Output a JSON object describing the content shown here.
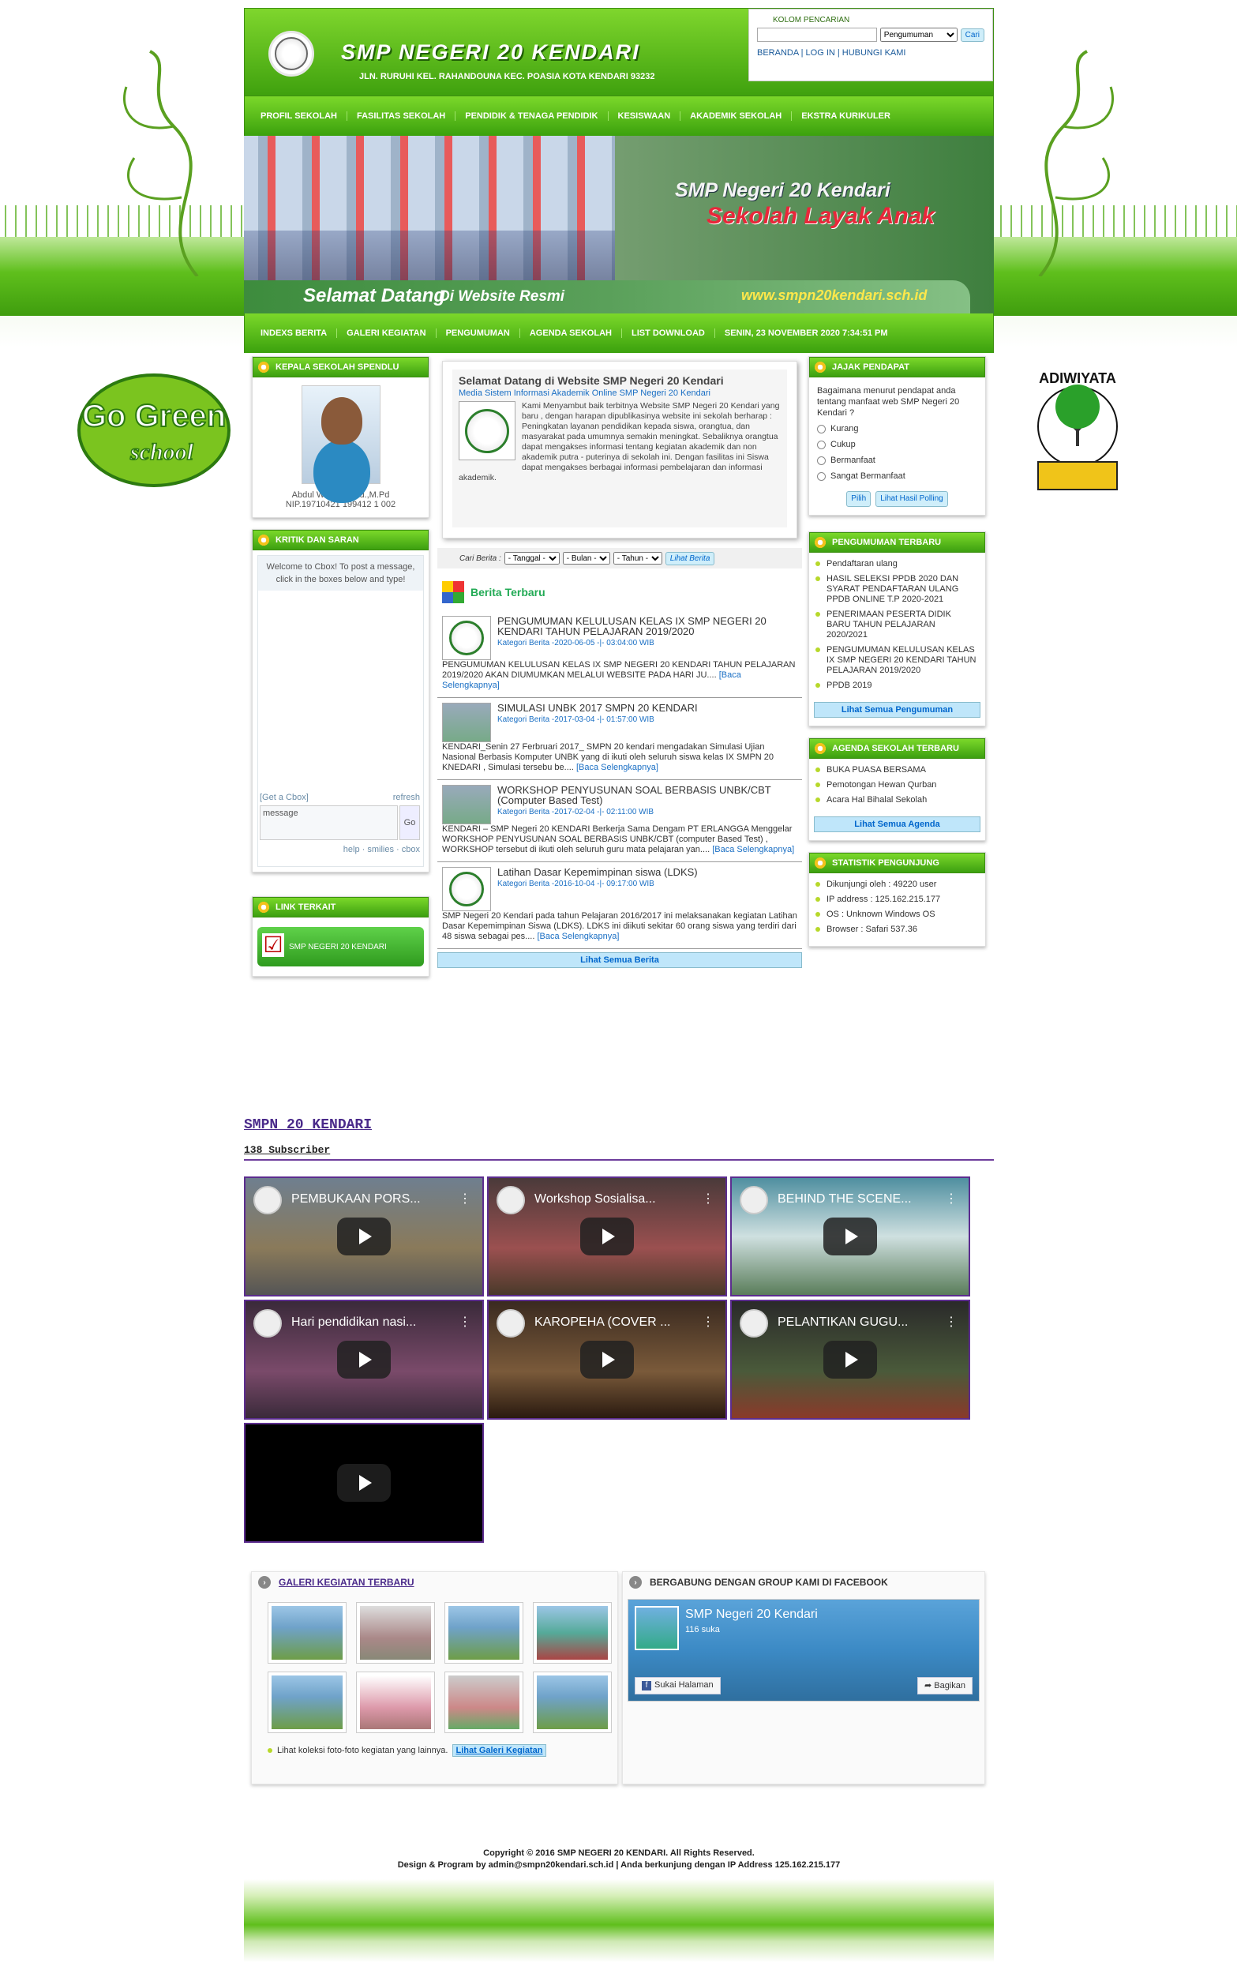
{
  "header": {
    "school_name": "SMP NEGERI 20 KENDARI",
    "address": "JLN. RURUHI KEL. RAHANDOUNA KEC. POASIA KOTA KENDARI 93232",
    "search_title": "KOLOM PENCARIAN",
    "search_select": "Pengumuman",
    "search_button": "Cari",
    "links": "BERANDA | LOG IN | HUBUNGI KAMI"
  },
  "nav1": [
    "PROFIL SEKOLAH",
    "FASILITAS SEKOLAH",
    "PENDIDIK & TENAGA PENDIDIK",
    "KESISWAAN",
    "AKADEMIK SEKOLAH",
    "EKSTRA KURIKULER"
  ],
  "banner": {
    "title": "SMP Negeri 20 Kendari",
    "subtitle": "Sekolah Layak Anak",
    "welcome1": "Selamat Datang",
    "welcome2": "Di Website Resmi",
    "url": "www.smpn20kendari.sch.id"
  },
  "nav2": [
    "INDEXS BERITA",
    "GALERI KEGIATAN",
    "PENGUMUMAN",
    "AGENDA SEKOLAH",
    "LIST DOWNLOAD",
    "SENIN, 23 NOVEMBER 2020 7:34:51 PM"
  ],
  "left": {
    "principal_title": "KEPALA SEKOLAH SPENDLU",
    "principal_name": "Abdul Wahid, S.Pd.,M.Pd",
    "principal_nip": "NIP.19710421 199412 1 002",
    "kritik_title": "KRITIK DAN SARAN",
    "cbox_welcome": "Welcome to Cbox! To post a message, click in the boxes below and type!",
    "cbox_get": "[Get a Cbox]",
    "cbox_refresh": "refresh",
    "cbox_message": "message",
    "cbox_go": "Go",
    "cbox_footer": "help · smilies · cbox",
    "link_title": "LINK TERKAIT",
    "link_button": "SMP NEGERI 20 KENDARI"
  },
  "welcome": {
    "title": "Selamat Datang di Website SMP Negeri 20 Kendari",
    "subtitle": "Media Sistem Informasi Akademik Online SMP Negeri 20 Kendari",
    "body": "Kami Menyambut baik terbitnya Website SMP Negeri 20 Kendari yang baru , dengan harapan dipublikasinya website ini sekolah berharap : Peningkatan layanan pendidikan kepada siswa, orangtua, dan masyarakat pada umumnya semakin meningkat. Sebaliknya orangtua dapat mengakses informasi tentang kegiatan akademik dan non akademik putra - puterinya di sekolah ini. Dengan fasilitas ini Siswa dapat mengakses berbagai informasi pembelajaran dan informasi akademik."
  },
  "cari": {
    "label": "Cari Berita :",
    "tanggal": "- Tanggal -",
    "bulan": "- Bulan -",
    "tahun": "- Tahun -",
    "button": "Lihat Berita"
  },
  "berita": {
    "title": "Berita Terbaru",
    "items": [
      {
        "title": "PENGUMUMAN KELULUSAN KELAS IX SMP NEGERI 20 KENDARI TAHUN PELAJARAN 2019/2020",
        "meta": "Kategori Berita -2020-06-05 -|- 03:04:00 WIB",
        "body": "PENGUMUMAN KELULUSAN KELAS IX SMP NEGERI 20 KENDARI TAHUN PELAJARAN 2019/2020 AKAN DIUMUMKAN MELALUI WEBSITE PADA HARI JU....",
        "more": "[Baca Selengkapnya]"
      },
      {
        "title": "SIMULASI UNBK 2017 SMPN 20 KENDARI",
        "meta": "Kategori Berita -2017-03-04 -|- 01:57:00 WIB",
        "body": "KENDARI_Senin 27 Ferbruari 2017_ SMPN 20 kendari mengadakan Simulasi Ujian Nasional Berbasis Komputer UNBK yang di ikuti oleh seluruh siswa kelas IX SMPN 20 KNEDARI , Simulasi tersebu be....",
        "more": "[Baca Selengkapnya]"
      },
      {
        "title": "WORKSHOP PENYUSUNAN SOAL BERBASIS UNBK/CBT (Computer Based Test)",
        "meta": "Kategori Berita -2017-02-04 -|- 02:11:00 WIB",
        "body": "KENDARI – SMP Negeri 20 KENDARI Berkerja Sama Dengam PT ERLANGGA Menggelar WORKSHOP PENYUSUNAN SOAL BERBASIS UNBK/CBT (computer Based Test) , WORKSHOP tersebut di ikuti oleh seluruh guru mata pelajaran yan....",
        "more": "[Baca Selengkapnya]"
      },
      {
        "title": "Latihan Dasar Kepemimpinan siswa (LDKS)",
        "meta": "Kategori Berita -2016-10-04 -|- 09:17:00 WIB",
        "body": "SMP Negeri 20 Kendari pada tahun Pelajaran 2016/2017 ini melaksanakan kegiatan Latihan Dasar Kepemimpinan Siswa (LDKS). LDKS ini diikuti sekitar 60 orang siswa yang terdiri dari 48 siswa sebagai pes....",
        "more": "[Baca Selengkapnya]"
      }
    ],
    "all": "Lihat Semua Berita"
  },
  "right": {
    "poll_title": "JAJAK PENDAPAT",
    "poll_q": "Bagaimana menurut pendapat anda tentang manfaat web SMP Negeri 20 Kendari ?",
    "poll_opts": [
      "Kurang",
      "Cukup",
      "Bermanfaat",
      "Sangat Bermanfaat"
    ],
    "poll_pilih": "Pilih",
    "poll_hasil": "Lihat Hasil Polling",
    "peng_title": "PENGUMUMAN TERBARU",
    "peng_items": [
      "Pendaftaran ulang",
      "HASIL SELEKSI PPDB 2020 DAN SYARAT PENDAFTARAN ULANG PPDB ONLINE T.P 2020-2021",
      "PENERIMAAN PESERTA DIDIK BARU TAHUN PELAJARAN 2020/2021",
      "PENGUMUMAN KELULUSAN KELAS IX SMP NEGERI 20 KENDARI TAHUN PELAJARAN 2019/2020",
      "PPDB 2019"
    ],
    "peng_all": "Lihat Semua Pengumuman",
    "agenda_title": "AGENDA SEKOLAH TERBARU",
    "agenda_items": [
      "BUKA PUASA BERSAMA",
      "Pemotongan Hewan Qurban",
      "Acara Hal Bihalal Sekolah"
    ],
    "agenda_all": "Lihat Semua Agenda",
    "stat_title": "STATISTIK PENGUNJUNG",
    "stat_items": [
      "Dikunjungi oleh : 49220 user",
      "IP address : 125.162.215.177",
      "OS : Unknown Windows OS",
      "Browser : Safari 537.36"
    ]
  },
  "badges": {
    "gogreen": "Go Green School",
    "adiwiyata": "ADIWIYATA"
  },
  "youtube": {
    "channel": "SMPN 20 KENDARI",
    "subscribers": "138 Subscriber",
    "videos": [
      "PEMBUKAAN PORS...",
      "Workshop Sosialisa...",
      "BEHIND THE SCENE...",
      "Hari pendidikan nasi...",
      "KAROPEHA (COVER ...",
      "PELANTIKAN GUGU...",
      ""
    ]
  },
  "galeri": {
    "title": "GALERI KEGIATAN TERBARU",
    "note": "Lihat koleksi foto-foto kegiatan yang lainnya.",
    "link": "Lihat Galeri Kegiatan"
  },
  "facebook": {
    "title": "BERGABUNG DENGAN GROUP KAMI DI FACEBOOK",
    "page": "SMP Negeri 20 Kendari",
    "likes": "116 suka",
    "like_btn": "Sukai Halaman",
    "share_btn": "Bagikan"
  },
  "footer": {
    "line1": "Copyright © 2016 SMP NEGERI 20 KENDARI. All Rights Reserved.",
    "line2": "Design & Program by admin@smpn20kendari.sch.id | Anda berkunjung dengan IP Address 125.162.215.177"
  }
}
